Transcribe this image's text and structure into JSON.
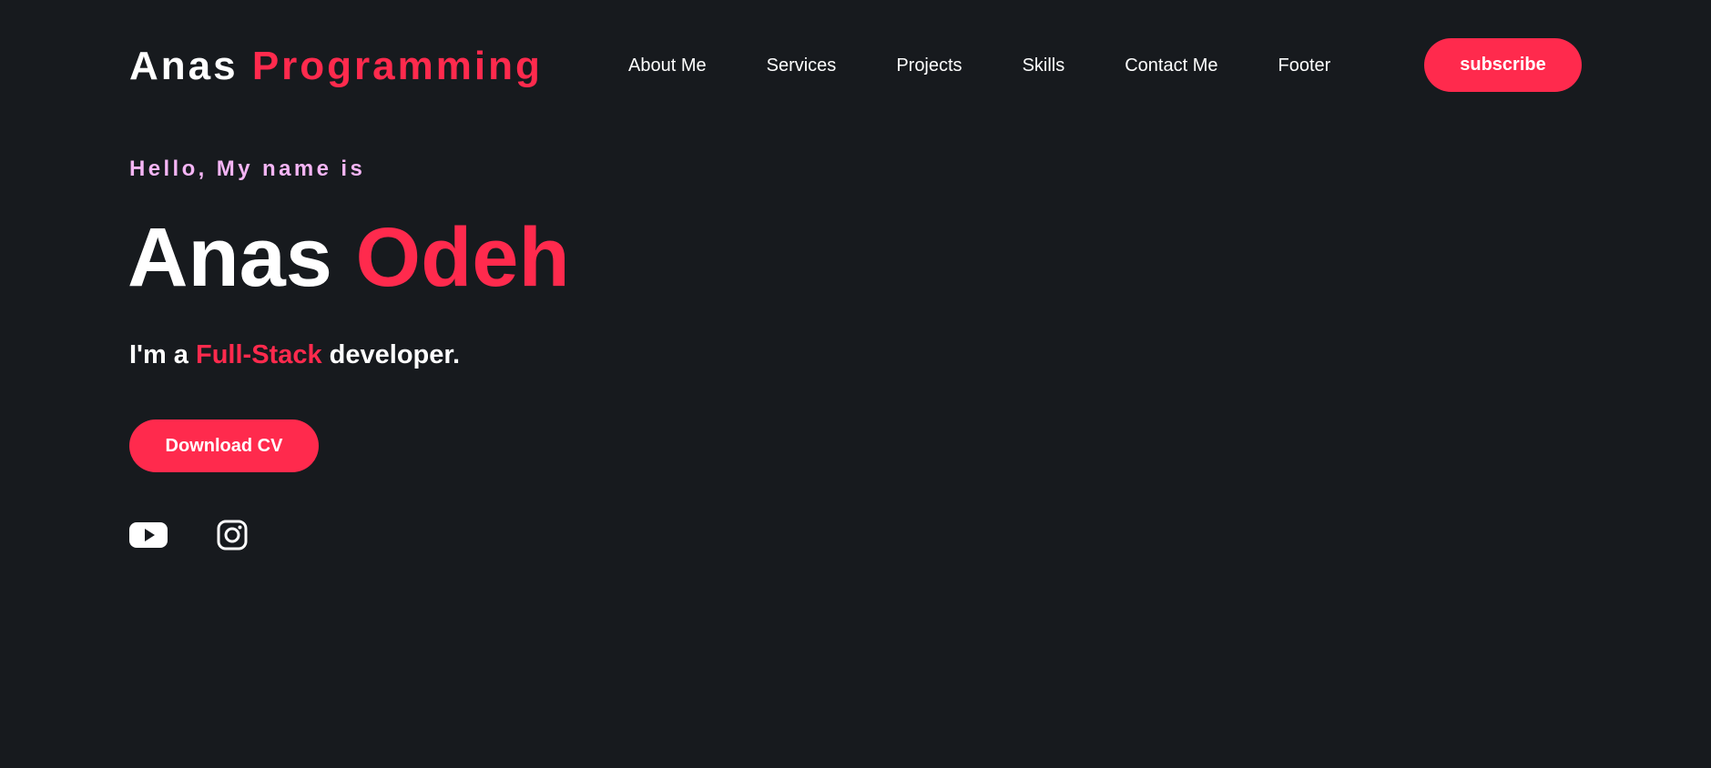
{
  "header": {
    "logo_first": "Anas",
    "logo_second": "Programming",
    "nav": [
      "About Me",
      "Services",
      "Projects",
      "Skills",
      "Contact Me",
      "Footer"
    ],
    "subscribe_label": "subscribe"
  },
  "hero": {
    "greeting": "Hello, My name is",
    "first_name": "Anas",
    "last_name": "Odeh",
    "role_prefix": "I'm a",
    "role_highlight": "Full-Stack",
    "role_suffix": "developer.",
    "download_label": "Download CV"
  },
  "socials": {
    "icons": [
      "youtube-icon",
      "instagram-icon"
    ]
  },
  "colors": {
    "background": "#171a1e",
    "accent": "#ff2a4d",
    "greeting": "#f5b5f5",
    "text": "#ffffff"
  }
}
